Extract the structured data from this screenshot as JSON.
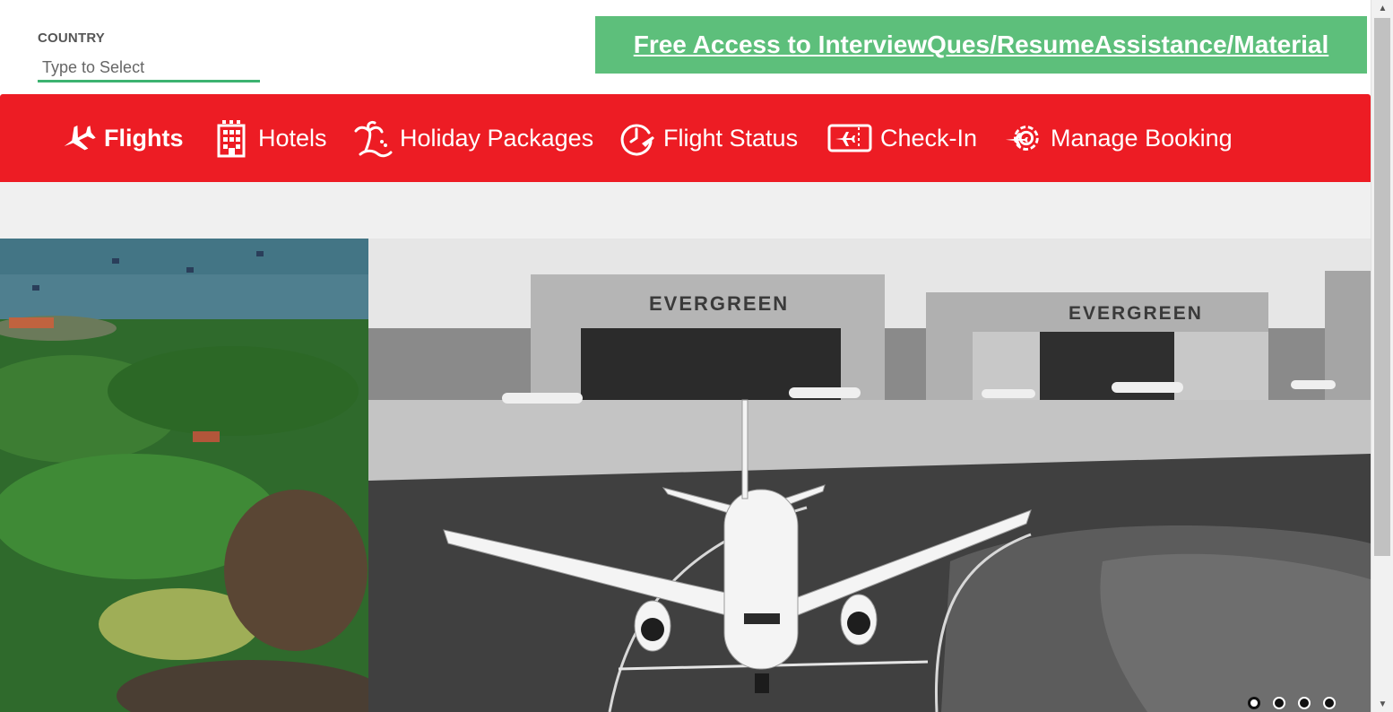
{
  "country": {
    "label": "COUNTRY",
    "placeholder": "Type to Select",
    "value": ""
  },
  "promo": {
    "text": "Free Access to InterviewQues/ResumeAssistance/Material"
  },
  "nav": {
    "items": [
      {
        "label": "Flights",
        "icon": "airplane-icon",
        "active": true
      },
      {
        "label": "Hotels",
        "icon": "hotel-building-icon",
        "active": false
      },
      {
        "label": "Holiday Packages",
        "icon": "palm-tree-icon",
        "active": false
      },
      {
        "label": "Flight Status",
        "icon": "clock-plane-icon",
        "active": false
      },
      {
        "label": "Check-In",
        "icon": "ticket-plane-icon",
        "active": false
      },
      {
        "label": "Manage Booking",
        "icon": "gear-plane-icon",
        "active": false
      }
    ]
  },
  "hero": {
    "slides_total": 4,
    "active_slide": 1,
    "hangar_sign": "EVERGREEN"
  },
  "colors": {
    "nav_red": "#ed1c24",
    "promo_green": "#5dbf7b",
    "input_underline": "#3cb371"
  }
}
